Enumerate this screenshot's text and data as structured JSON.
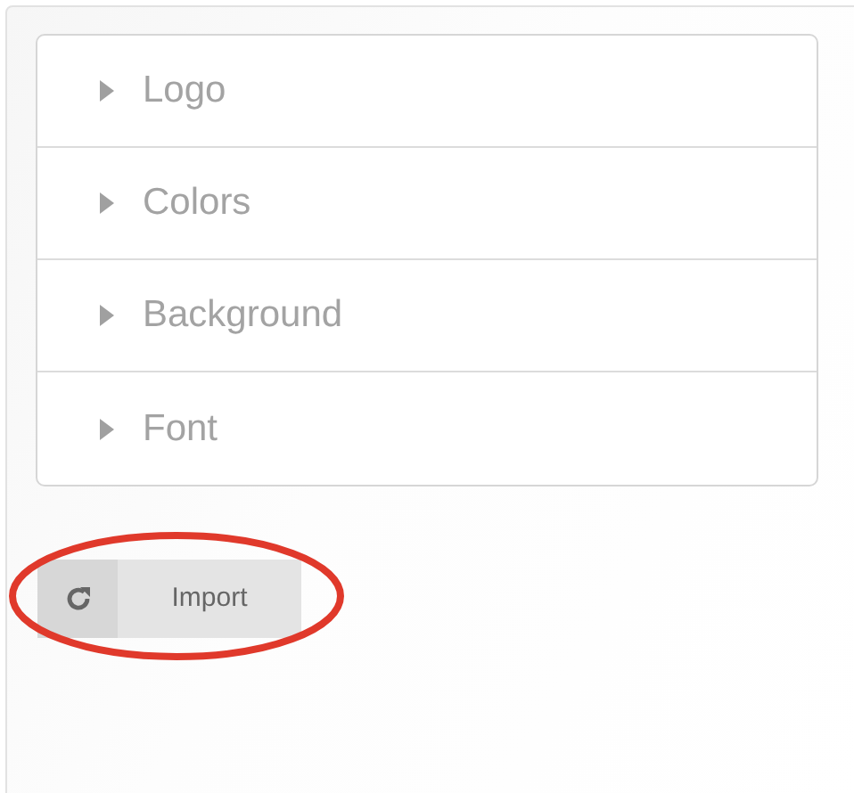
{
  "sections": [
    {
      "label": "Logo",
      "expanded": false
    },
    {
      "label": "Colors",
      "expanded": false
    },
    {
      "label": "Background",
      "expanded": false
    },
    {
      "label": "Font",
      "expanded": false
    }
  ],
  "import_button": {
    "label": "Import"
  },
  "annotation": {
    "kind": "ellipse",
    "color": "#e0392b"
  }
}
